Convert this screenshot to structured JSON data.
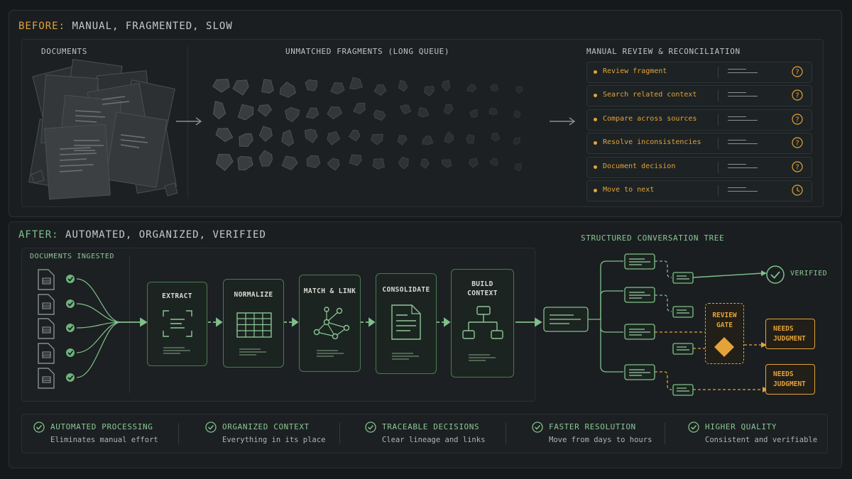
{
  "before": {
    "heading_label": "BEFORE:",
    "heading_rest": "MANUAL, FRAGMENTED, SLOW",
    "documents_title": "DOCUMENTS",
    "fragments_title": "UNMATCHED FRAGMENTS (LONG QUEUE)",
    "review_title": "MANUAL REVIEW & RECONCILIATION",
    "tasks": [
      {
        "label": "Review fragment",
        "icon": "question-icon"
      },
      {
        "label": "Search related context",
        "icon": "question-icon"
      },
      {
        "label": "Compare across sources",
        "icon": "question-icon"
      },
      {
        "label": "Resolve inconsistencies",
        "icon": "question-icon"
      },
      {
        "label": "Document decision",
        "icon": "question-icon"
      },
      {
        "label": "Move to next",
        "icon": "clock-icon"
      }
    ]
  },
  "after": {
    "heading_label": "AFTER:",
    "heading_rest": "AUTOMATED, ORGANIZED, VERIFIED",
    "ingested_title": "DOCUMENTS INGESTED",
    "stages": {
      "extract": "EXTRACT",
      "normalize": "NORMALIZE",
      "match": "MATCH & LINK",
      "consolidate": "CONSOLIDATE",
      "build_line1": "BUILD",
      "build_line2": "CONTEXT"
    },
    "tree_title": "STRUCTURED CONVERSATION TREE",
    "verified": "VERIFIED",
    "gate_line1": "REVIEW",
    "gate_line2": "GATE",
    "needs_line1": "NEEDS",
    "needs_line2": "JUDGMENT"
  },
  "features": [
    {
      "title": "AUTOMATED PROCESSING",
      "desc": "Eliminates manual effort"
    },
    {
      "title": "ORGANIZED CONTEXT",
      "desc": "Everything in its place"
    },
    {
      "title": "TRACEABLE DECISIONS",
      "desc": "Clear lineage and links"
    },
    {
      "title": "FASTER RESOLUTION",
      "desc": "Move from days to hours"
    },
    {
      "title": "HIGHER QUALITY",
      "desc": "Consistent and verifiable"
    }
  ],
  "colors": {
    "amber": "#e3a33a",
    "green": "#7fc08a",
    "background": "#16191b"
  }
}
